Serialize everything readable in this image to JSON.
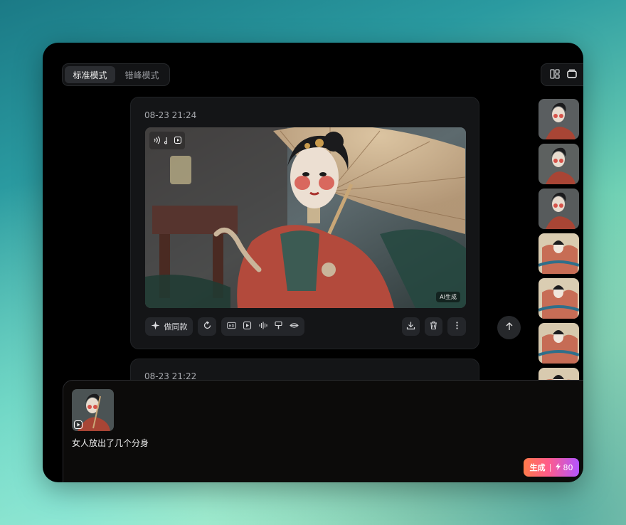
{
  "modes": {
    "standard": "标准模式",
    "staggered": "错峰模式"
  },
  "cards": [
    {
      "time": "08-23 21:24",
      "ai_tag": "AI生成"
    },
    {
      "time": "08-23 21:22"
    }
  ],
  "toolbar": {
    "same_style_label": "做同款"
  },
  "composer": {
    "prompt": "女人放出了几个分身"
  },
  "generate": {
    "label": "生成",
    "credits": "80"
  },
  "colors": {
    "accent_start": "#ff7a4a",
    "accent_mid": "#ff5b8c",
    "accent_end": "#b355ff"
  }
}
